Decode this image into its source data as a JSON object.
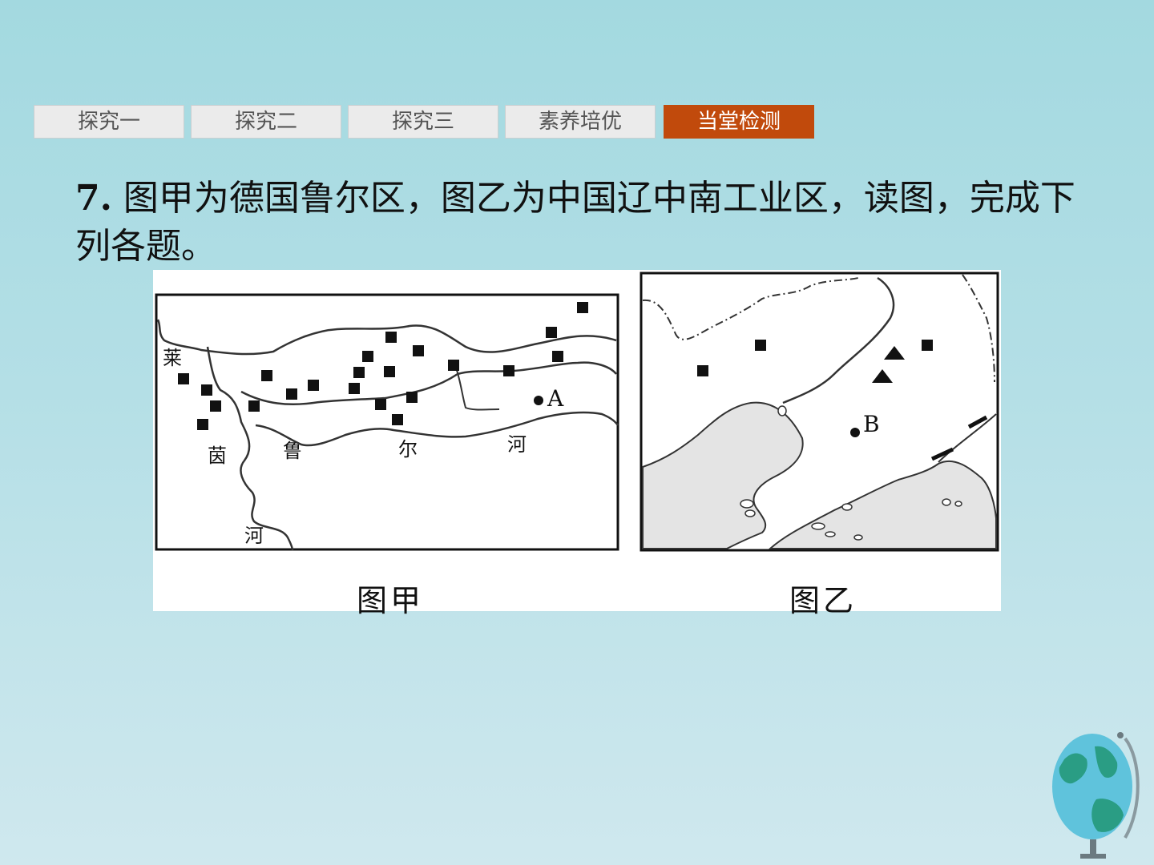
{
  "nav": {
    "tabs": [
      {
        "label": "探究一",
        "active": false
      },
      {
        "label": "探究二",
        "active": false
      },
      {
        "label": "探究三",
        "active": false
      },
      {
        "label": "素养培优",
        "active": false
      },
      {
        "label": "当堂检测",
        "active": true
      }
    ]
  },
  "question": {
    "number": "7.",
    "text": " 图甲为德国鲁尔区，图乙为中国辽中南工业区，读图，完成下列各题。"
  },
  "figure": {
    "map_a": {
      "caption": "图甲",
      "point_label": "A",
      "river_rhine": [
        "莱",
        "茵",
        "河"
      ],
      "river_ruhr": [
        "鲁",
        "尔",
        "河"
      ]
    },
    "map_b": {
      "caption": "图乙",
      "point_label": "B"
    }
  },
  "colors": {
    "active_tab": "#c14a0c",
    "tab_bg": "#ebebeb",
    "sea_fill": "#e4e4e4"
  }
}
